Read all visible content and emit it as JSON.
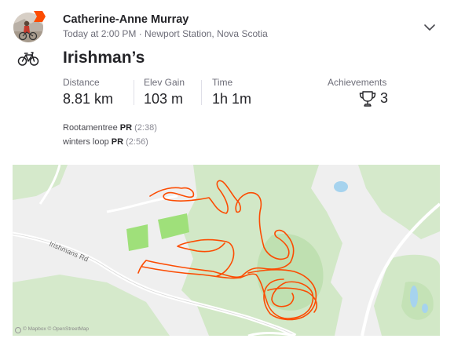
{
  "athlete": {
    "name": "Catherine-Anne Murray"
  },
  "activity": {
    "meta": "Today at 2:00 PM · Newport Station, Nova Scotia",
    "sport_icon": "bike-icon",
    "title": "Irishman’s"
  },
  "stats": [
    {
      "label": "Distance",
      "value": "8.81 km"
    },
    {
      "label": "Elev Gain",
      "value": "103 m"
    },
    {
      "label": "Time",
      "value": "1h 1m"
    }
  ],
  "achievements": {
    "label": "Achievements",
    "icon": "trophy-icon",
    "count": "3"
  },
  "segments": [
    {
      "name": "Rootamentree",
      "badge": "PR",
      "time": "(2:38)"
    },
    {
      "name": "winters loop",
      "badge": "PR",
      "time": "(2:56)"
    }
  ],
  "map": {
    "road_label": "Irishmans Rd",
    "attribution": "© Mapbox © OpenStreetMap",
    "route_color": "#fc4c02",
    "park_color": "#cfe7c3",
    "field_color": "#9fe07a",
    "water_color": "#a6d3ee"
  },
  "colors": {
    "brand": "#fc4c02",
    "text_primary": "#242428",
    "text_secondary": "#6d6d78"
  }
}
